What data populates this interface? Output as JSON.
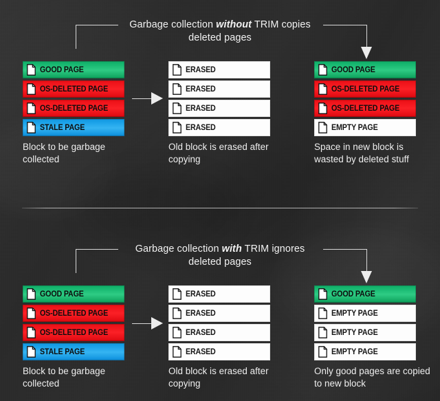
{
  "theme": {
    "background": "#2b2b2b",
    "text": "#f2f2f2",
    "good_page": "#22c57e",
    "deleted_page": "#f8181f",
    "stale_page": "#30b1ef",
    "empty_page": "#ffffff",
    "connector": "#d8d8d8"
  },
  "sections": [
    {
      "id": "without-trim",
      "headline": {
        "before": "Garbage collection ",
        "emphasis": "without",
        "after": " TRIM copies",
        "line2": "deleted pages"
      },
      "columns": [
        {
          "id": "source-block",
          "rows": [
            {
              "label": "GOOD PAGE",
              "state": "green",
              "icon": "page-icon"
            },
            {
              "label": "OS-DELETED PAGE",
              "state": "red",
              "icon": "page-icon"
            },
            {
              "label": "OS-DELETED PAGE",
              "state": "red",
              "icon": "page-icon"
            },
            {
              "label": "STALE PAGE",
              "state": "blue",
              "icon": "page-icon"
            }
          ],
          "caption": "Block to be garbage collected"
        },
        {
          "id": "erased-block",
          "rows": [
            {
              "label": "ERASED",
              "state": "white",
              "icon": "page-icon"
            },
            {
              "label": "ERASED",
              "state": "white",
              "icon": "page-icon"
            },
            {
              "label": "ERASED",
              "state": "white",
              "icon": "page-icon"
            },
            {
              "label": "ERASED",
              "state": "white",
              "icon": "page-icon"
            }
          ],
          "caption": "Old block is erased after copying"
        },
        {
          "id": "destination-block",
          "rows": [
            {
              "label": "GOOD PAGE",
              "state": "green",
              "icon": "page-icon"
            },
            {
              "label": "OS-DELETED PAGE",
              "state": "red",
              "icon": "page-icon"
            },
            {
              "label": "OS-DELETED PAGE",
              "state": "red",
              "icon": "page-icon"
            },
            {
              "label": "EMPTY PAGE",
              "state": "white",
              "icon": "page-icon"
            }
          ],
          "caption": "Space in new block is wasted by deleted stuff"
        }
      ]
    },
    {
      "id": "with-trim",
      "headline": {
        "before": "Garbage collection ",
        "emphasis": "with",
        "after": " TRIM ignores",
        "line2": "deleted pages"
      },
      "columns": [
        {
          "id": "source-block",
          "rows": [
            {
              "label": "GOOD PAGE",
              "state": "green",
              "icon": "page-icon"
            },
            {
              "label": "OS-DELETED PAGE",
              "state": "red",
              "icon": "page-icon"
            },
            {
              "label": "OS-DELETED PAGE",
              "state": "red",
              "icon": "page-icon"
            },
            {
              "label": "STALE PAGE",
              "state": "blue",
              "icon": "page-icon"
            }
          ],
          "caption": "Block to be garbage collected"
        },
        {
          "id": "erased-block",
          "rows": [
            {
              "label": "ERASED",
              "state": "white",
              "icon": "page-icon"
            },
            {
              "label": "ERASED",
              "state": "white",
              "icon": "page-icon"
            },
            {
              "label": "ERASED",
              "state": "white",
              "icon": "page-icon"
            },
            {
              "label": "ERASED",
              "state": "white",
              "icon": "page-icon"
            }
          ],
          "caption": "Old block is erased after copying"
        },
        {
          "id": "destination-block",
          "rows": [
            {
              "label": "GOOD PAGE",
              "state": "green",
              "icon": "page-icon"
            },
            {
              "label": "EMPTY PAGE",
              "state": "white",
              "icon": "page-icon"
            },
            {
              "label": "EMPTY PAGE",
              "state": "white",
              "icon": "page-icon"
            },
            {
              "label": "EMPTY PAGE",
              "state": "white",
              "icon": "page-icon"
            }
          ],
          "caption": "Only good pages are copied to new block"
        }
      ]
    }
  ]
}
